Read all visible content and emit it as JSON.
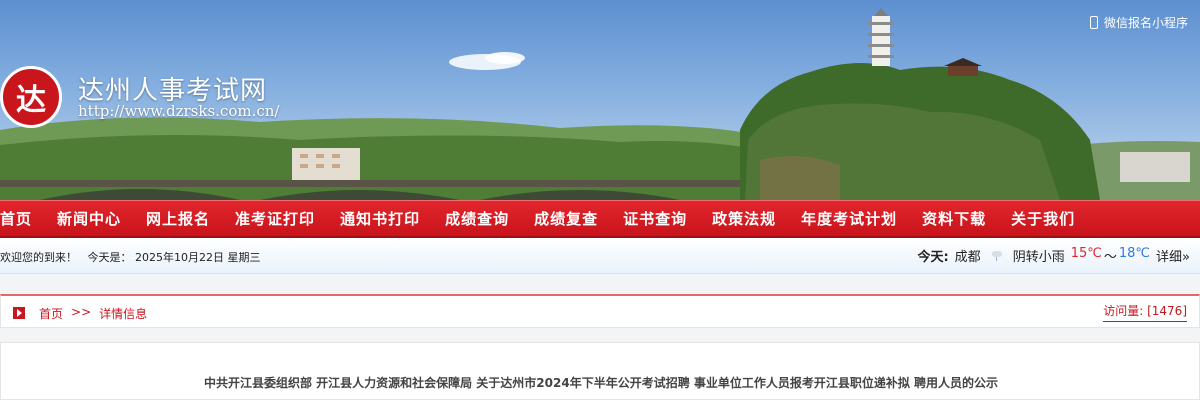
{
  "banner": {
    "logo_text": "达",
    "site_title": "达州人事考试网",
    "site_url": "http://www.dzrsks.com.cn/",
    "miniprogram_label": "微信报名小程序"
  },
  "nav": {
    "items": [
      {
        "label": "首页"
      },
      {
        "label": "新闻中心"
      },
      {
        "label": "网上报名"
      },
      {
        "label": "准考证打印"
      },
      {
        "label": "通知书打印"
      },
      {
        "label": "成绩查询"
      },
      {
        "label": "成绩复查"
      },
      {
        "label": "证书查询"
      },
      {
        "label": "政策法规"
      },
      {
        "label": "年度考试计划"
      },
      {
        "label": "资料下载"
      },
      {
        "label": "关于我们"
      }
    ]
  },
  "infobar": {
    "welcome": "欢迎您的到来！",
    "today_prefix": "今天是：",
    "date": "2025年10月22日 星期三",
    "weather": {
      "label": "今天:",
      "city": "成都",
      "condition": "阴转小雨",
      "high": "15℃",
      "separator": "～",
      "low": "18℃",
      "detail": "详细»",
      "icon": "light-rain-icon"
    }
  },
  "breadcrumb": {
    "home": "首页",
    "separator": ">>",
    "current": "详情信息",
    "visits_label": "访问量:",
    "visits_count": "[1476]"
  },
  "article": {
    "title": "中共开江县委组织部 开江县人力资源和社会保障局 关于达州市2024年下半年公开考试招聘 事业单位工作人员报考开江县职位递补拟 聘用人员的公示"
  },
  "colors": {
    "brand_red": "#c9161d",
    "temp_high": "#e0262d",
    "temp_low": "#2c7bd6"
  }
}
